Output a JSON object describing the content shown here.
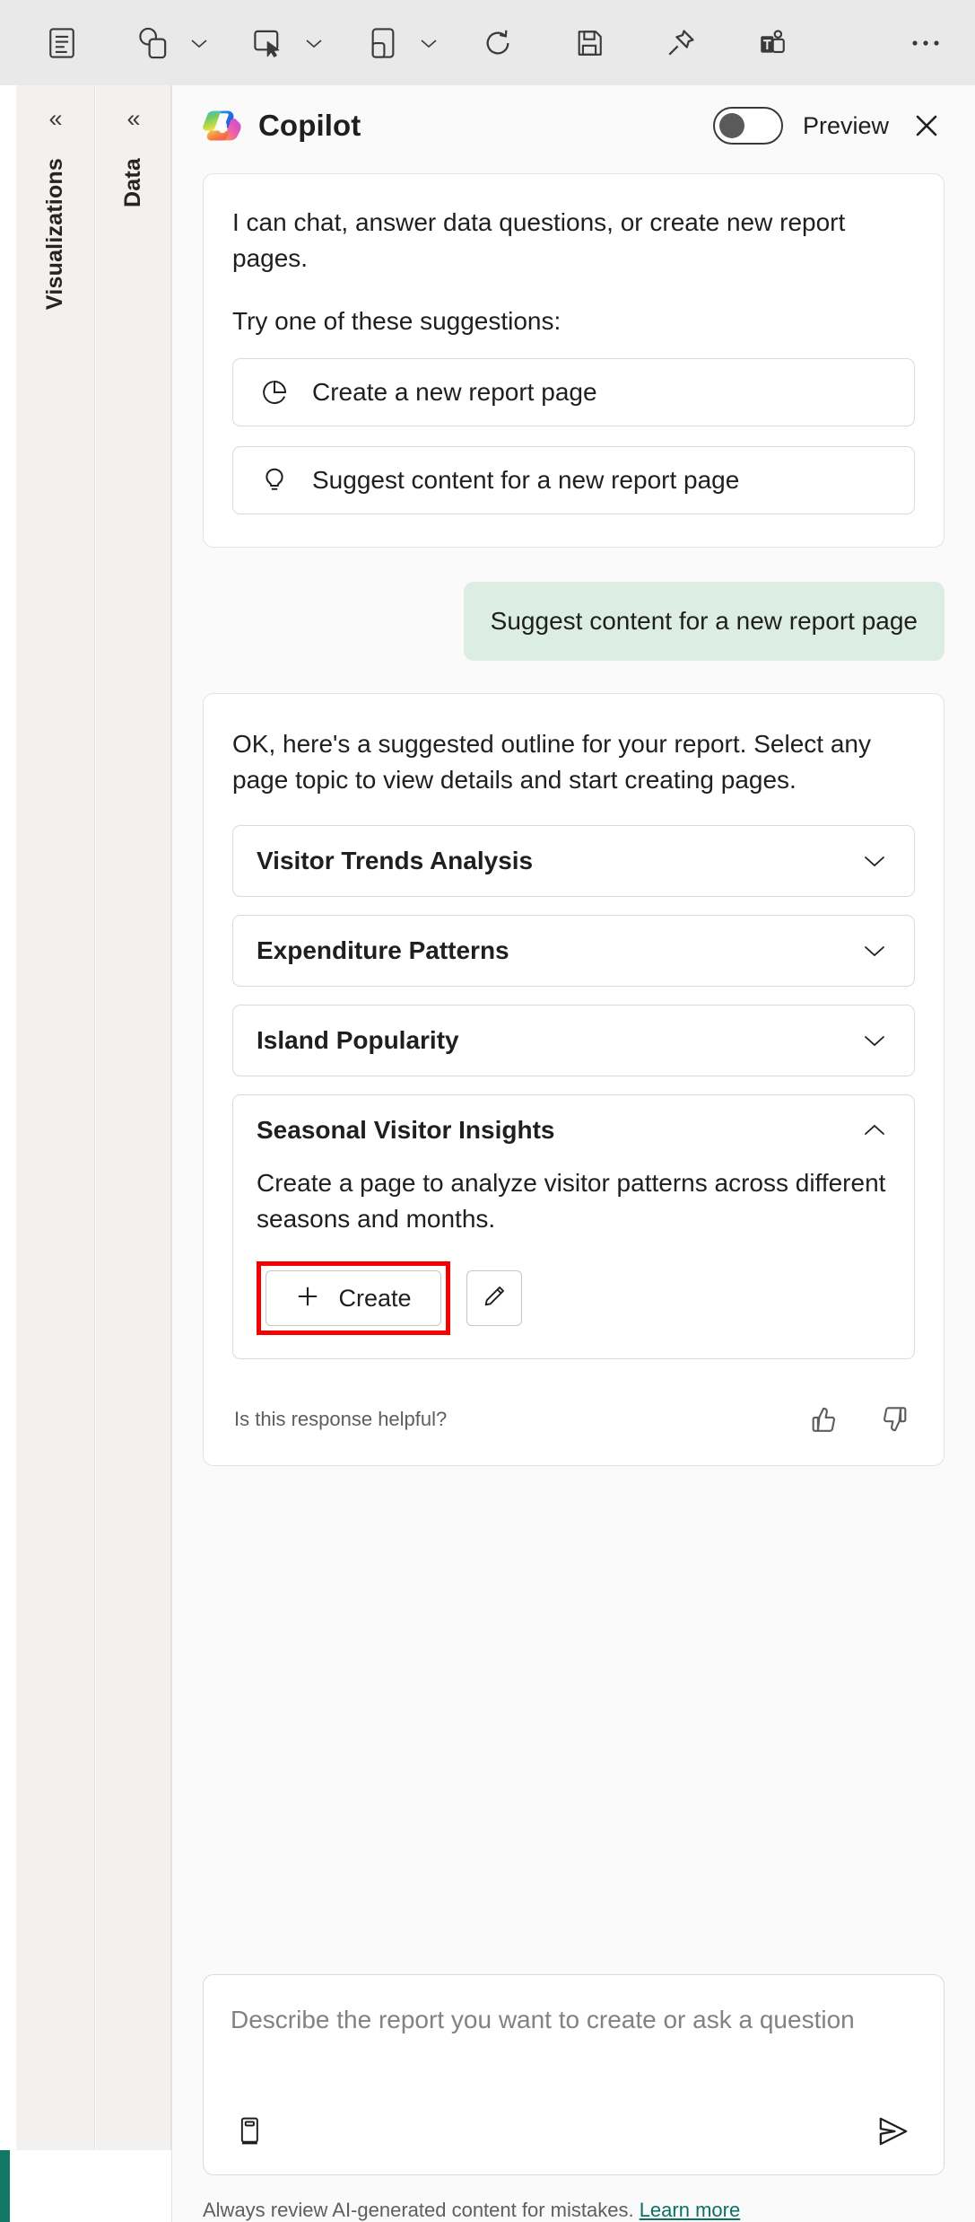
{
  "toolbar": {
    "items": [
      {
        "name": "text-box-icon",
        "label": "Text box"
      },
      {
        "name": "shapes-icon",
        "label": "Shapes",
        "has_chevron": true
      },
      {
        "name": "buttons-icon",
        "label": "Buttons",
        "has_chevron": true
      },
      {
        "name": "page-icon",
        "label": "New page",
        "has_chevron": true
      },
      {
        "name": "refresh-icon",
        "label": "Refresh"
      },
      {
        "name": "save-icon",
        "label": "Save"
      },
      {
        "name": "pin-icon",
        "label": "Pin to dashboard"
      },
      {
        "name": "teams-icon",
        "label": "Share to Teams"
      },
      {
        "name": "more-options-icon",
        "label": "More options"
      }
    ]
  },
  "panes": [
    {
      "name": "visualizations",
      "label": "Visualizations",
      "collapse_glyph": "«"
    },
    {
      "name": "data",
      "label": "Data",
      "collapse_glyph": "«"
    }
  ],
  "copilot": {
    "title": "Copilot",
    "preview_label": "Preview",
    "toggle_on": false,
    "close_label": "Close",
    "intro": {
      "line1": "I can chat, answer data questions, or create new report pages.",
      "line2": "Try one of these suggestions:",
      "suggestions": [
        {
          "icon": "pie-chart-icon",
          "label": "Create a new report page"
        },
        {
          "icon": "lightbulb-icon",
          "label": "Suggest content for a new report page"
        }
      ]
    },
    "user_message": "Suggest content for a new report page",
    "reply": {
      "text": "OK, here's a suggested outline for your report. Select any page topic to view details and start creating pages.",
      "topics": [
        {
          "title": "Visitor Trends Analysis",
          "expanded": false,
          "chevron": "chevron-down-icon"
        },
        {
          "title": "Expenditure Patterns",
          "expanded": false,
          "chevron": "chevron-down-icon"
        },
        {
          "title": "Island Popularity",
          "expanded": false,
          "chevron": "chevron-down-icon"
        },
        {
          "title": "Seasonal Visitor Insights",
          "expanded": true,
          "chevron": "chevron-up-icon",
          "description": "Create a page to analyze visitor patterns across different seasons and months.",
          "create_label": "Create",
          "edit_label": "Edit"
        }
      ],
      "feedback_question": "Is this response helpful?",
      "thumbs_up_label": "Helpful",
      "thumbs_down_label": "Not helpful"
    },
    "composer": {
      "placeholder": "Describe the report you want to create or ask a question",
      "prompt_guide_label": "Prompt guide",
      "send_label": "Send"
    },
    "disclaimer": {
      "text": "Always review AI-generated content for mistakes.",
      "link": "Learn more"
    }
  },
  "colors": {
    "accent_green": "#117865",
    "user_bubble": "#dceee4",
    "highlight_red": "#f50000",
    "link_green": "#0b7262",
    "toolbar_bg": "#e9e9e9",
    "panel_bg": "#fafafa"
  }
}
